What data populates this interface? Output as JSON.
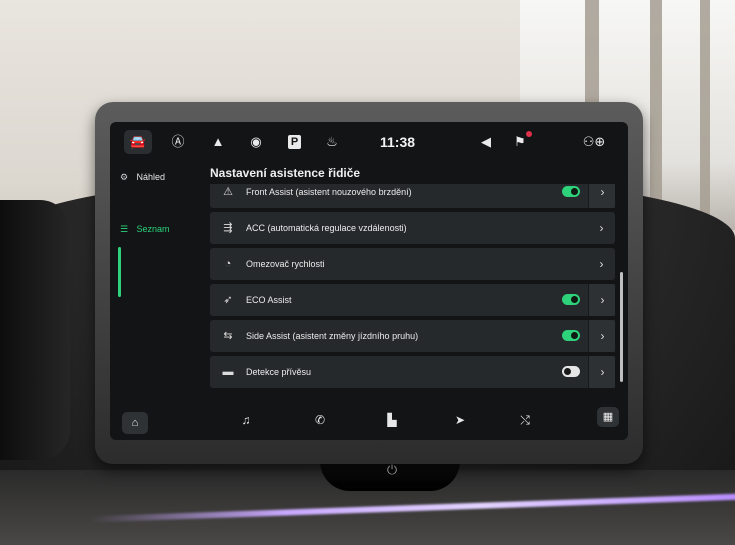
{
  "status_bar": {
    "time": "11:38",
    "icons": [
      "car-icon",
      "assist-icon",
      "warning-triangle-icon",
      "camera-icon",
      "parking-icon",
      "seat-heating-icon",
      "volume-icon",
      "notification-icon",
      "profile-icon"
    ],
    "parking_label": "P"
  },
  "nav": {
    "items": [
      {
        "label": "Náhled",
        "icon": "overview-icon"
      },
      {
        "label": "Seznam",
        "icon": "list-icon"
      }
    ]
  },
  "page": {
    "title": "Nastavení asistence řidiče"
  },
  "list": {
    "items": [
      {
        "label": "Front Assist (asistent nouzového brzdění)",
        "toggle": true,
        "icon": "front-assist-icon"
      },
      {
        "label": "ACC (automatická regulace vzdálenosti)",
        "toggle": null,
        "icon": "acc-icon"
      },
      {
        "label": "Omezovač rychlosti",
        "toggle": null,
        "icon": "speed-limiter-icon"
      },
      {
        "label": "ECO Assist",
        "toggle": true,
        "icon": "eco-assist-icon"
      },
      {
        "label": "Side Assist (asistent změny jízdního pruhu)",
        "toggle": true,
        "icon": "side-assist-icon"
      },
      {
        "label": "Detekce přívěsu",
        "toggle": false,
        "icon": "trailer-icon"
      }
    ]
  },
  "bottom_bar": {
    "icons": [
      "home-icon",
      "music-icon",
      "phone-icon",
      "apps-grid-icon",
      "navigation-icon",
      "connect-icon",
      "menu-grid-icon"
    ]
  },
  "colors": {
    "accent": "#2dd27a",
    "screen_bg": "#121416",
    "row_bg": "#26292c"
  }
}
